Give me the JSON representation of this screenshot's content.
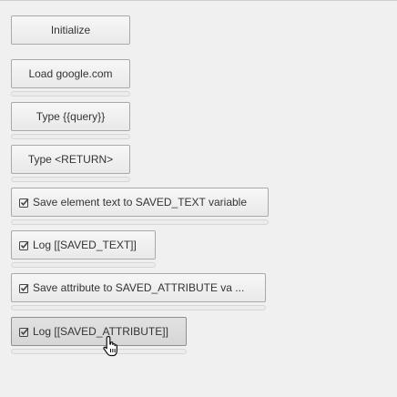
{
  "steps": [
    {
      "label": "Initialize",
      "checked": false
    },
    {
      "label": "Load google.com",
      "checked": false
    },
    {
      "label": "Type {{query}}",
      "checked": false
    },
    {
      "label": "Type <RETURN>",
      "checked": false
    },
    {
      "label": "Save element text to SAVED_TEXT variable",
      "checked": true
    },
    {
      "label": "Log [[SAVED_TEXT]]",
      "checked": true
    },
    {
      "label": "Save attribute to SAVED_ATTRIBUTE va ...",
      "checked": true
    },
    {
      "label": "Log [[SAVED_ATTRIBUTE]]",
      "checked": true
    }
  ],
  "icons": {
    "checkbox": "checked-checkbox-icon",
    "cursor": "hand-pointer-icon"
  }
}
